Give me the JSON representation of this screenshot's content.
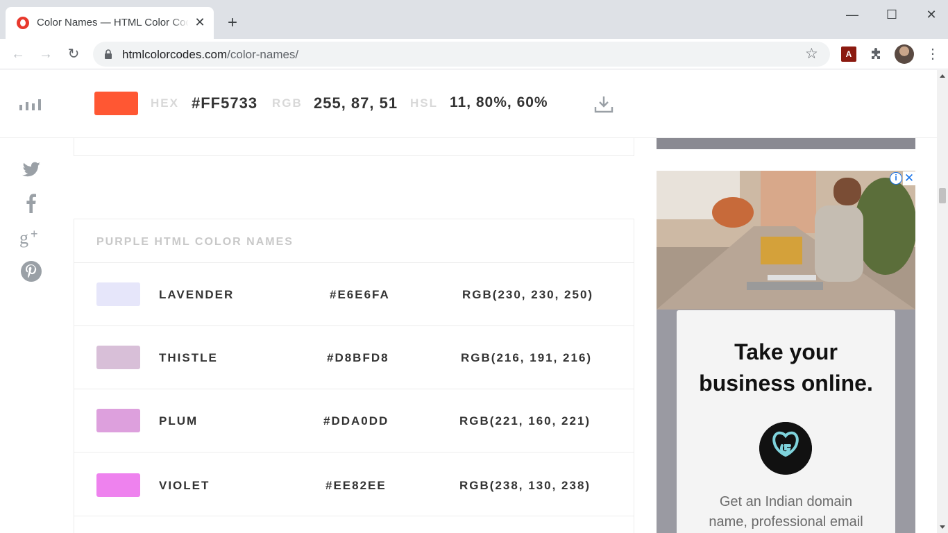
{
  "browser": {
    "tab_title": "Color Names — HTML Color Codes",
    "tab_close": "✕",
    "new_tab": "+",
    "window_minimize": "—",
    "window_maximize": "☐",
    "window_close": "✕",
    "url_host": "htmlcolorcodes.com",
    "url_path": "/color-names/",
    "pdf_ext_label": "A",
    "menu": "⋮"
  },
  "color_bar": {
    "swatch_color": "#FF5733",
    "hex_label": "HEX",
    "hex_value": "#FF5733",
    "rgb_label": "RGB",
    "rgb_value": "255, 87, 51",
    "hsl_label": "HSL",
    "hsl_value": "11, 80%, 60%"
  },
  "social": [
    "twitter-icon",
    "facebook-icon",
    "google-plus-icon",
    "pinterest-icon"
  ],
  "section": {
    "title": "PURPLE HTML COLOR NAMES",
    "rows": [
      {
        "name": "LAVENDER",
        "hex": "#E6E6FA",
        "rgb": "RGB(230, 230, 250)",
        "color": "#E6E6FA"
      },
      {
        "name": "THISTLE",
        "hex": "#D8BFD8",
        "rgb": "RGB(216, 191, 216)",
        "color": "#D8BFD8"
      },
      {
        "name": "PLUM",
        "hex": "#DDA0DD",
        "rgb": "RGB(221, 160, 221)",
        "color": "#DDA0DD"
      },
      {
        "name": "VIOLET",
        "hex": "#EE82EE",
        "rgb": "RGB(238, 130, 238)",
        "color": "#EE82EE"
      }
    ]
  },
  "ad": {
    "headline_line1": "Take your",
    "headline_line2": "business online.",
    "body_line1": "Get an Indian domain",
    "body_line2": "name, professional email",
    "info": "i",
    "close": "✕"
  }
}
